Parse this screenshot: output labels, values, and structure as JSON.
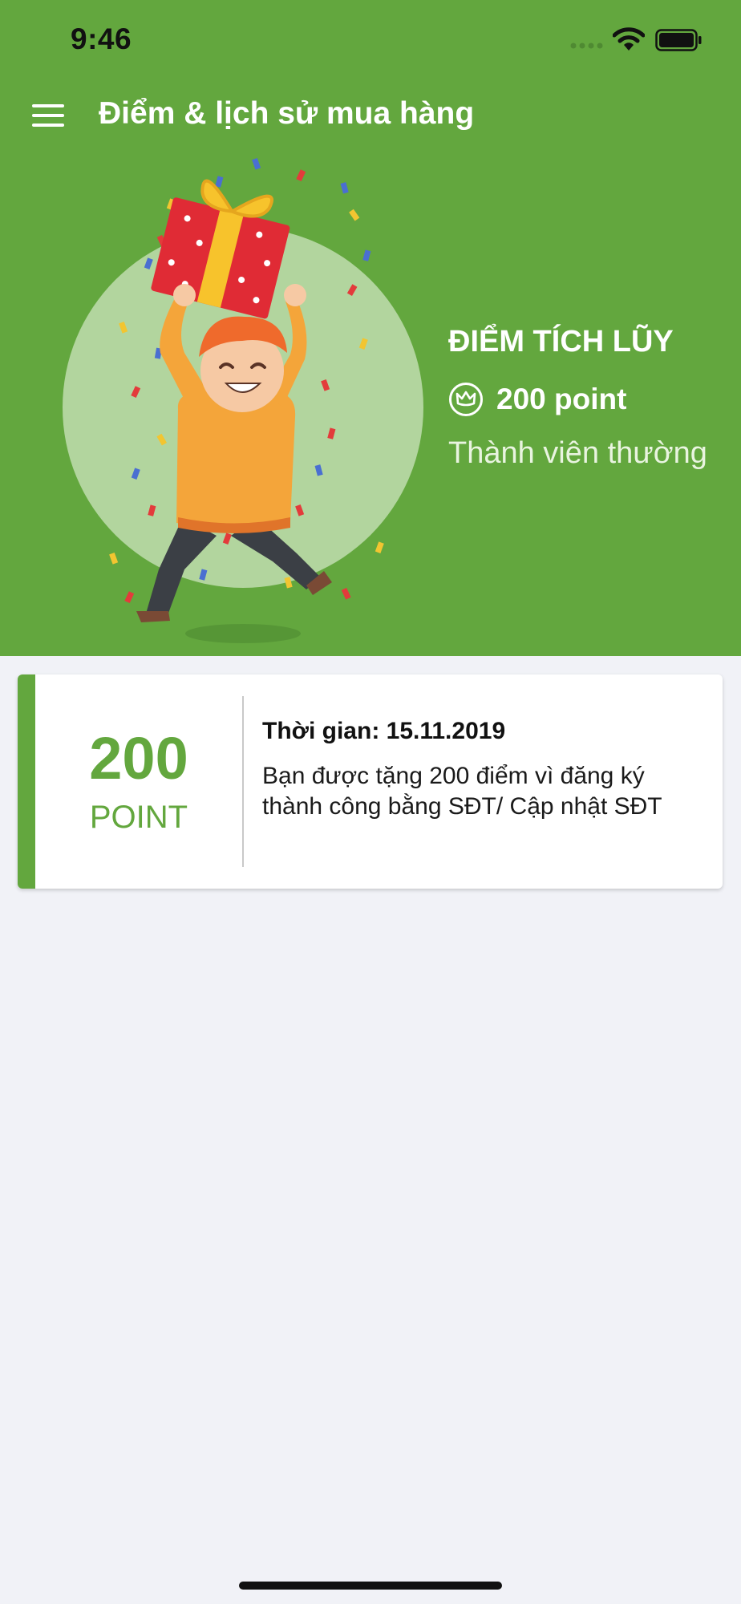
{
  "status_bar": {
    "time": "9:46"
  },
  "header": {
    "title": "Điểm & lịch sử mua hàng"
  },
  "summary": {
    "heading": "ĐIỂM TÍCH LŨY",
    "points": "200 point",
    "tier": "Thành viên thường"
  },
  "history": [
    {
      "points_value": "200",
      "points_unit": "POINT",
      "time": "Thời gian: 15.11.2019",
      "description": "Bạn được tặng 200 điểm vì đăng ký thành công bằng SĐT/ Cập nhật SĐT"
    }
  ],
  "colors": {
    "brand_green": "#63a73e",
    "page_background": "#f1f2f7",
    "card_background": "#ffffff"
  },
  "icons": {
    "menu": "hamburger-icon",
    "badge": "crown-icon",
    "signal": "cellular-signal-icon",
    "wifi": "wifi-icon",
    "battery": "battery-icon"
  }
}
